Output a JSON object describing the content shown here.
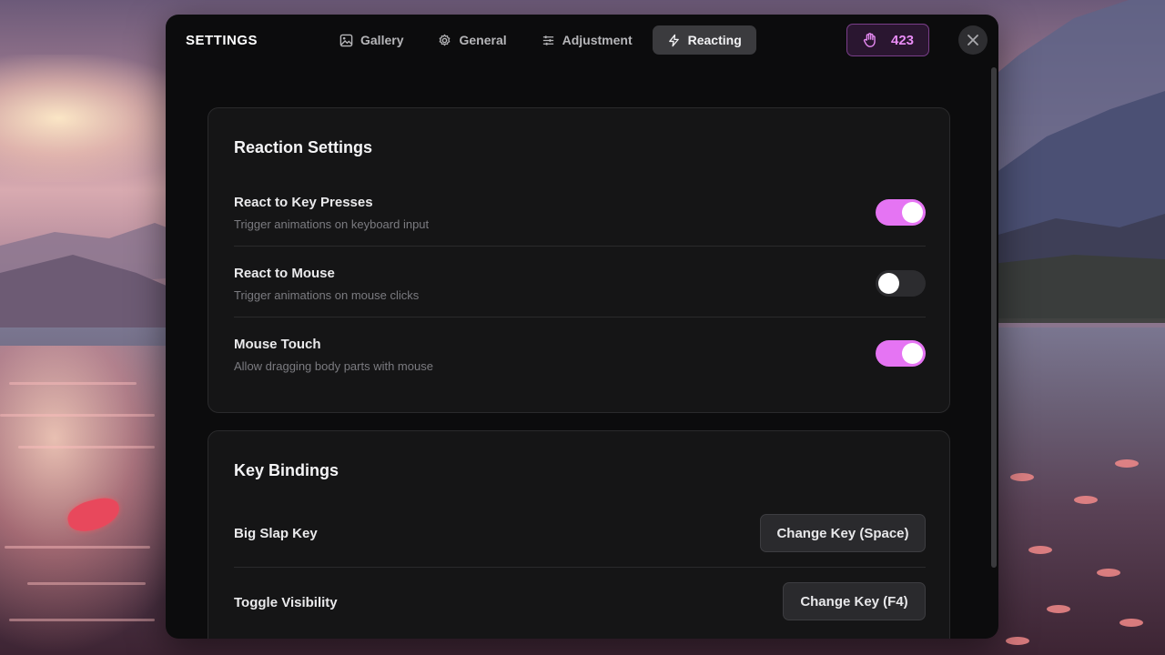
{
  "window": {
    "title": "SETTINGS",
    "counter_value": "423"
  },
  "tabs": [
    {
      "label": "Gallery",
      "icon": "image-icon",
      "active": false
    },
    {
      "label": "General",
      "icon": "gear-icon",
      "active": false
    },
    {
      "label": "Adjustment",
      "icon": "sliders-icon",
      "active": false
    },
    {
      "label": "Reacting",
      "icon": "lightning-icon",
      "active": true
    }
  ],
  "reaction_settings": {
    "title": "Reaction Settings",
    "items": [
      {
        "label": "React to Key Presses",
        "description": "Trigger animations on keyboard input",
        "enabled": true
      },
      {
        "label": "React to Mouse",
        "description": "Trigger animations on mouse clicks",
        "enabled": false
      },
      {
        "label": "Mouse Touch",
        "description": "Allow dragging body parts with mouse",
        "enabled": true
      }
    ]
  },
  "key_bindings": {
    "title": "Key Bindings",
    "items": [
      {
        "label": "Big Slap Key",
        "button_label": "Change Key (Space)"
      },
      {
        "label": "Toggle Visibility",
        "button_label": "Change Key (F4)"
      }
    ]
  },
  "colors": {
    "accent": "#e574f3",
    "counter_text": "#e98cf6",
    "window_bg": "#0c0c0d",
    "card_bg": "#151516"
  }
}
